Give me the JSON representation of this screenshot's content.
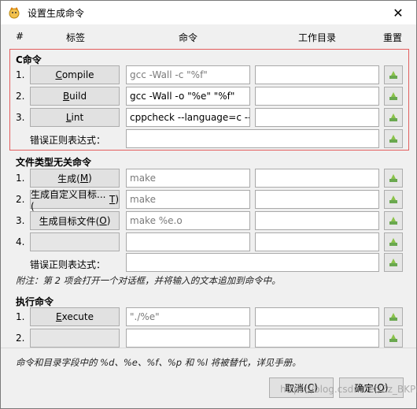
{
  "window": {
    "title": "设置生成命令",
    "close_glyph": "✕"
  },
  "headers": {
    "num": "#",
    "label": "标签",
    "command": "命令",
    "workdir": "工作目录",
    "reset": "重置"
  },
  "c_section": {
    "title": "C命令",
    "rows": [
      {
        "num": "1.",
        "label_pre": "",
        "label_u": "C",
        "label_post": "ompile",
        "command": "gcc -Wall -c \"%f\"",
        "command_dim": true,
        "workdir": ""
      },
      {
        "num": "2.",
        "label_pre": "",
        "label_u": "B",
        "label_post": "uild",
        "command": "gcc -Wall -o \"%e\" \"%f\"",
        "command_dim": false,
        "workdir": ""
      },
      {
        "num": "3.",
        "label_pre": "",
        "label_u": "L",
        "label_post": "int",
        "command": "cppcheck --language=c --",
        "command_dim": false,
        "workdir": ""
      }
    ],
    "regex_label": "错误正则表达式：",
    "regex_value": ""
  },
  "indep_section": {
    "title": "文件类型无关命令",
    "rows": [
      {
        "num": "1.",
        "label_pre": "生成(",
        "label_u": "M",
        "label_post": ")",
        "command": "make",
        "workdir": ""
      },
      {
        "num": "2.",
        "label_pre": "生成自定义目标...(",
        "label_u": "T",
        "label_post": ")",
        "command": "make",
        "workdir": ""
      },
      {
        "num": "3.",
        "label_pre": "生成目标文件(",
        "label_u": "O",
        "label_post": ")",
        "command": "make %e.o",
        "workdir": ""
      },
      {
        "num": "4.",
        "label_pre": "",
        "label_u": "",
        "label_post": "",
        "command": "",
        "workdir": ""
      }
    ],
    "regex_label": "错误正则表达式：",
    "regex_value": "",
    "note": "附注：第 2 项会打开一个对话框，并将输入的文本追加到命令中。"
  },
  "exec_section": {
    "title": "执行命令",
    "rows": [
      {
        "num": "1.",
        "label_pre": "",
        "label_u": "E",
        "label_post": "xecute",
        "command": "\"./%e\"",
        "workdir": ""
      },
      {
        "num": "2.",
        "label_pre": "",
        "label_u": "",
        "label_post": "",
        "command": "",
        "workdir": ""
      }
    ]
  },
  "footer_note": "命令和目录字段中的 %d、%e、%f、%p 和 %l 将被替代，详见手册。",
  "buttons": {
    "cancel_pre": "取消(",
    "cancel_u": "C",
    "cancel_post": ")",
    "ok_pre": "确定(",
    "ok_u": "O",
    "ok_post": ")"
  },
  "watermark": "https://blog.csdn.net/Zz_BKPD",
  "colors": {
    "highlight_border": "#e35d5d",
    "reset_icon": "#6aa84f"
  }
}
